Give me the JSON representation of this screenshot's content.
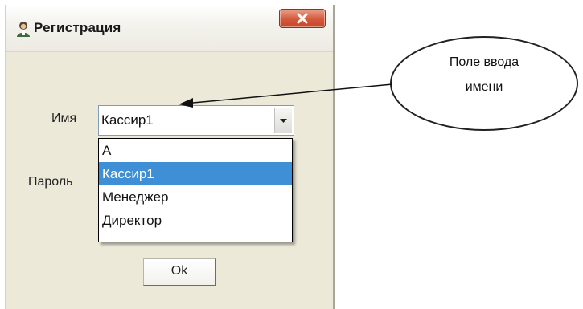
{
  "window": {
    "title": "Регистрация",
    "icon": "user-icon",
    "close_icon": "close-icon"
  },
  "form": {
    "name_label": "Имя",
    "name_value": "Кассир1",
    "password_label": "Пароль",
    "dropdown_options": [
      {
        "label": "А",
        "selected": false
      },
      {
        "label": "Кассир1",
        "selected": true
      },
      {
        "label": "Менеджер",
        "selected": false
      },
      {
        "label": "Директор",
        "selected": false
      }
    ],
    "ok_label": "Ok"
  },
  "callout": {
    "line1": "Поле ввода",
    "line2": "имени"
  },
  "colors": {
    "selection": "#3f8fd6",
    "close_button": "#d4583a",
    "window_bg": "#ece9d8"
  }
}
